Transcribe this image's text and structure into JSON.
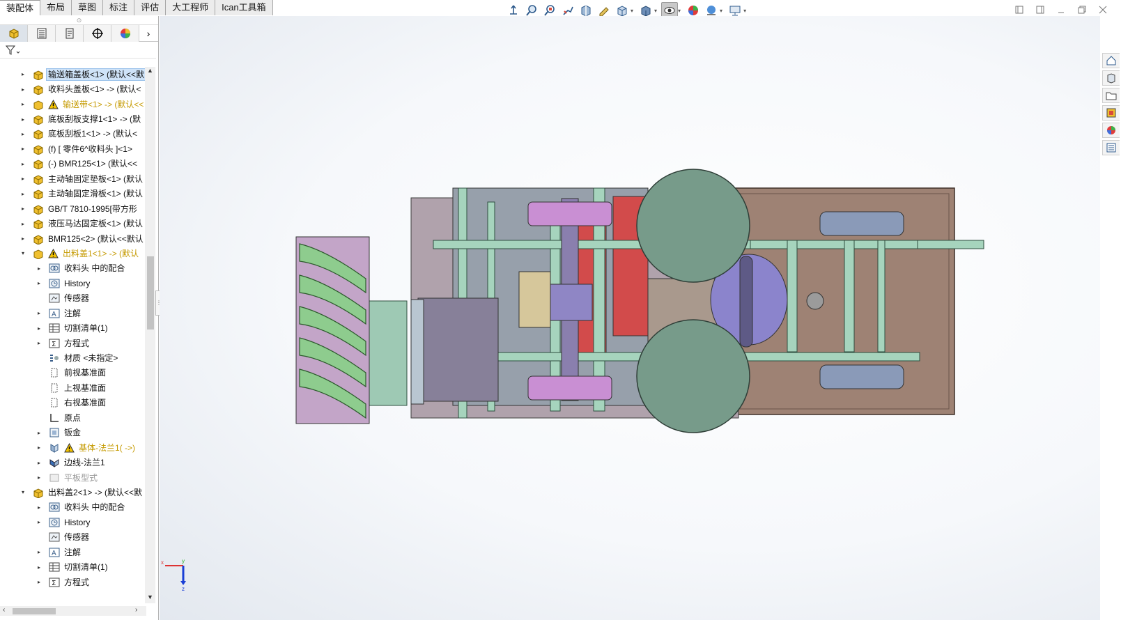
{
  "tabs": [
    "装配体",
    "布局",
    "草图",
    "标注",
    "评估",
    "大工程师",
    "Ican工具箱"
  ],
  "panel_tabs": [
    "feature-manager",
    "property-manager",
    "configuration-manager",
    "dimxpert-manager",
    "display-manager"
  ],
  "tree": [
    {
      "label": "输送箱盖板<1> (默认<<默",
      "level": 0,
      "expander": "▸",
      "icon": "part",
      "state": "selected"
    },
    {
      "label": "收料头盖板<1> -> (默认<",
      "level": 0,
      "expander": "▸",
      "icon": "part",
      "state": "normal"
    },
    {
      "label": "输送带<1> -> (默认<<",
      "level": 0,
      "expander": "▸",
      "icon": "part-warning",
      "state": "warning"
    },
    {
      "label": "底板刮板支撑1<1> -> (默",
      "level": 0,
      "expander": "▸",
      "icon": "part",
      "state": "normal"
    },
    {
      "label": "底板刮板1<1> -> (默认<",
      "level": 0,
      "expander": "▸",
      "icon": "part",
      "state": "normal"
    },
    {
      "label": "(f) [ 零件6^收料头 ]<1>",
      "level": 0,
      "expander": "▸",
      "icon": "part",
      "state": "normal"
    },
    {
      "label": "(-) BMR125<1> (默认<<",
      "level": 0,
      "expander": "▸",
      "icon": "part",
      "state": "normal"
    },
    {
      "label": "主动轴固定垫板<1> (默认",
      "level": 0,
      "expander": "▸",
      "icon": "part",
      "state": "normal"
    },
    {
      "label": "主动轴固定滑板<1> (默认",
      "level": 0,
      "expander": "▸",
      "icon": "part",
      "state": "normal"
    },
    {
      "label": "GB/T 7810-1995[带方形",
      "level": 0,
      "expander": "▸",
      "icon": "part",
      "state": "normal"
    },
    {
      "label": "液压马达固定板<1> (默认",
      "level": 0,
      "expander": "▸",
      "icon": "part",
      "state": "normal"
    },
    {
      "label": "BMR125<2> (默认<<默认",
      "level": 0,
      "expander": "▸",
      "icon": "part",
      "state": "normal"
    },
    {
      "label": "出料盖1<1> -> (默认",
      "level": 0,
      "expander": "▾",
      "icon": "part-warning",
      "state": "warning"
    },
    {
      "label": "收料头 中的配合",
      "level": 1,
      "expander": "▸",
      "icon": "mates",
      "state": "normal"
    },
    {
      "label": "History",
      "level": 1,
      "expander": "▸",
      "icon": "history",
      "state": "normal"
    },
    {
      "label": "传感器",
      "level": 1,
      "expander": "",
      "icon": "sensor",
      "state": "normal"
    },
    {
      "label": "注解",
      "level": 1,
      "expander": "▸",
      "icon": "annotation",
      "state": "normal"
    },
    {
      "label": "切割清单(1)",
      "level": 1,
      "expander": "▸",
      "icon": "cutlist",
      "state": "normal"
    },
    {
      "label": "方程式",
      "level": 1,
      "expander": "▸",
      "icon": "equation",
      "state": "normal"
    },
    {
      "label": "材质 <未指定>",
      "level": 1,
      "expander": "",
      "icon": "material",
      "state": "normal"
    },
    {
      "label": "前视基准面",
      "level": 1,
      "expander": "",
      "icon": "plane",
      "state": "normal"
    },
    {
      "label": "上视基准面",
      "level": 1,
      "expander": "",
      "icon": "plane",
      "state": "normal"
    },
    {
      "label": "右视基准面",
      "level": 1,
      "expander": "",
      "icon": "plane",
      "state": "normal"
    },
    {
      "label": "原点",
      "level": 1,
      "expander": "",
      "icon": "origin",
      "state": "normal"
    },
    {
      "label": "钣金",
      "level": 1,
      "expander": "▸",
      "icon": "sheetmetal",
      "state": "normal"
    },
    {
      "label": "基体-法兰1( ->)",
      "level": 1,
      "expander": "▸",
      "icon": "flange-warning",
      "state": "warning"
    },
    {
      "label": "边线-法兰1",
      "level": 1,
      "expander": "▸",
      "icon": "edgeflange",
      "state": "normal"
    },
    {
      "label": "平板型式",
      "level": 1,
      "expander": "▸",
      "icon": "flat",
      "state": "dim"
    },
    {
      "label": "出料盖2<1> -> (默认<<默",
      "level": 0,
      "expander": "▾",
      "icon": "part",
      "state": "normal"
    },
    {
      "label": "收料头 中的配合",
      "level": 1,
      "expander": "▸",
      "icon": "mates",
      "state": "normal"
    },
    {
      "label": "History",
      "level": 1,
      "expander": "▸",
      "icon": "history",
      "state": "normal"
    },
    {
      "label": "传感器",
      "level": 1,
      "expander": "",
      "icon": "sensor",
      "state": "normal"
    },
    {
      "label": "注解",
      "level": 1,
      "expander": "▸",
      "icon": "annotation",
      "state": "normal"
    },
    {
      "label": "切割清单(1)",
      "level": 1,
      "expander": "▸",
      "icon": "cutlist",
      "state": "normal"
    },
    {
      "label": "方程式",
      "level": 1,
      "expander": "▸",
      "icon": "equation",
      "state": "normal"
    }
  ],
  "heads_up_tools": [
    "view-orientation-icon",
    "zoom-to-fit-icon",
    "zoom-to-area-icon",
    "previous-view-icon",
    "section-view-icon",
    "dynamic-annotation-icon",
    "view-orientation-menu-icon",
    "display-style-icon",
    "hide-show-items-icon",
    "edit-appearance-icon",
    "apply-scene-icon",
    "view-settings-icon"
  ],
  "task_pane": [
    "home-icon",
    "design-library-icon",
    "file-explorer-icon",
    "view-palette-icon",
    "appearances-icon",
    "custom-properties-icon"
  ],
  "triad": {
    "x": "x",
    "y": "y",
    "z": "z"
  }
}
